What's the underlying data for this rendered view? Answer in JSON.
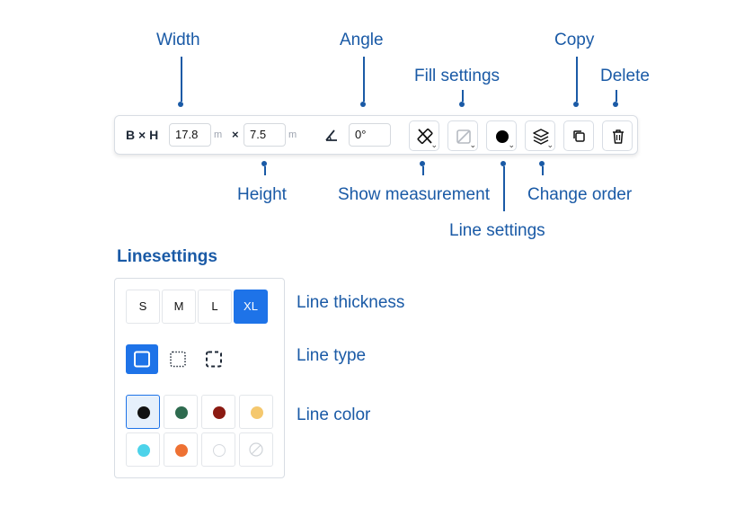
{
  "annotations": {
    "width": "Width",
    "angle": "Angle",
    "fill_settings": "Fill settings",
    "copy": "Copy",
    "delete": "Delete",
    "height": "Height",
    "show_measurement": "Show measurement",
    "change_order": "Change order",
    "line_settings": "Line settings"
  },
  "toolbar": {
    "dims_label": "B × H",
    "width_value": "17.8",
    "width_unit": "m",
    "times": "×",
    "height_value": "7.5",
    "height_unit": "m",
    "angle_icon": "angle-icon",
    "angle_value": "0°",
    "buttons": [
      "ruler-off-icon",
      "fill-none-icon",
      "line-color-icon",
      "layers-icon",
      "copy-icon",
      "trash-icon"
    ]
  },
  "line_settings": {
    "title": "Linesettings",
    "thickness_label": "Line thickness",
    "thickness_options": [
      "S",
      "M",
      "L",
      "XL"
    ],
    "thickness_selected": "XL",
    "type_label": "Line type",
    "type_options": [
      "solid",
      "dotted",
      "dashed"
    ],
    "type_selected": "solid",
    "color_label": "Line color",
    "colors": [
      "#111111",
      "#2e6b4f",
      "#8b1a12",
      "#f5c86e",
      "#4dd3ea",
      "#ee7133",
      "#ffffff",
      "none"
    ],
    "color_selected": "#111111"
  },
  "accent_color": "#1e73e8",
  "annotation_color": "#1a5aa6"
}
